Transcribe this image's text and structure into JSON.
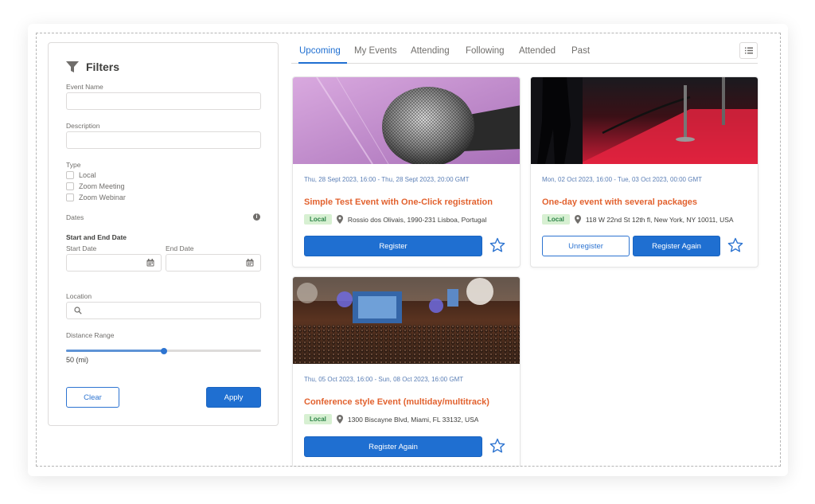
{
  "filters": {
    "title": "Filters",
    "event_name_label": "Event Name",
    "event_name_value": "",
    "description_label": "Description",
    "description_value": "",
    "type_label": "Type",
    "type_options": [
      "Local",
      "Zoom Meeting",
      "Zoom Webinar"
    ],
    "dates_label": "Dates",
    "start_end_label": "Start and End Date",
    "start_date_label": "Start Date",
    "end_date_label": "End Date",
    "location_label": "Location",
    "distance_label": "Distance Range",
    "distance_value": "50 (mi)",
    "distance_fraction": 0.5,
    "clear_label": "Clear",
    "apply_label": "Apply"
  },
  "tabs": [
    "Upcoming",
    "My Events",
    "Attending",
    "Following",
    "Attended",
    "Past"
  ],
  "active_tab": "Upcoming",
  "events": [
    {
      "date": "Thu, 28 Sept 2023, 16:00 - Thu, 28 Sept 2023, 20:00 GMT",
      "title": "Simple Test Event with One-Click registration",
      "badge": "Local",
      "address": "Rossio dos Olivais, 1990-231 Lisboa, Portugal",
      "buttons": [
        "Register"
      ]
    },
    {
      "date": "Mon, 02 Oct 2023, 16:00 - Tue, 03 Oct 2023, 00:00 GMT",
      "title": "One-day event with several packages",
      "badge": "Local",
      "address": "118 W 22nd St 12th fl, New York, NY 10011, USA",
      "buttons": [
        "Unregister",
        "Register Again"
      ]
    },
    {
      "date": "Thu, 05 Oct 2023, 16:00 - Sun, 08 Oct 2023, 16:00 GMT",
      "title": "Conference style Event (multiday/multitrack)",
      "badge": "Local",
      "address": "1300 Biscayne Blvd, Miami, FL 33132, USA",
      "buttons": [
        "Register Again"
      ]
    }
  ],
  "colors": {
    "accent": "#1f6fd1",
    "event_title": "#e2622f",
    "badge_bg": "#d7f0d2",
    "badge_text": "#2e844a"
  }
}
